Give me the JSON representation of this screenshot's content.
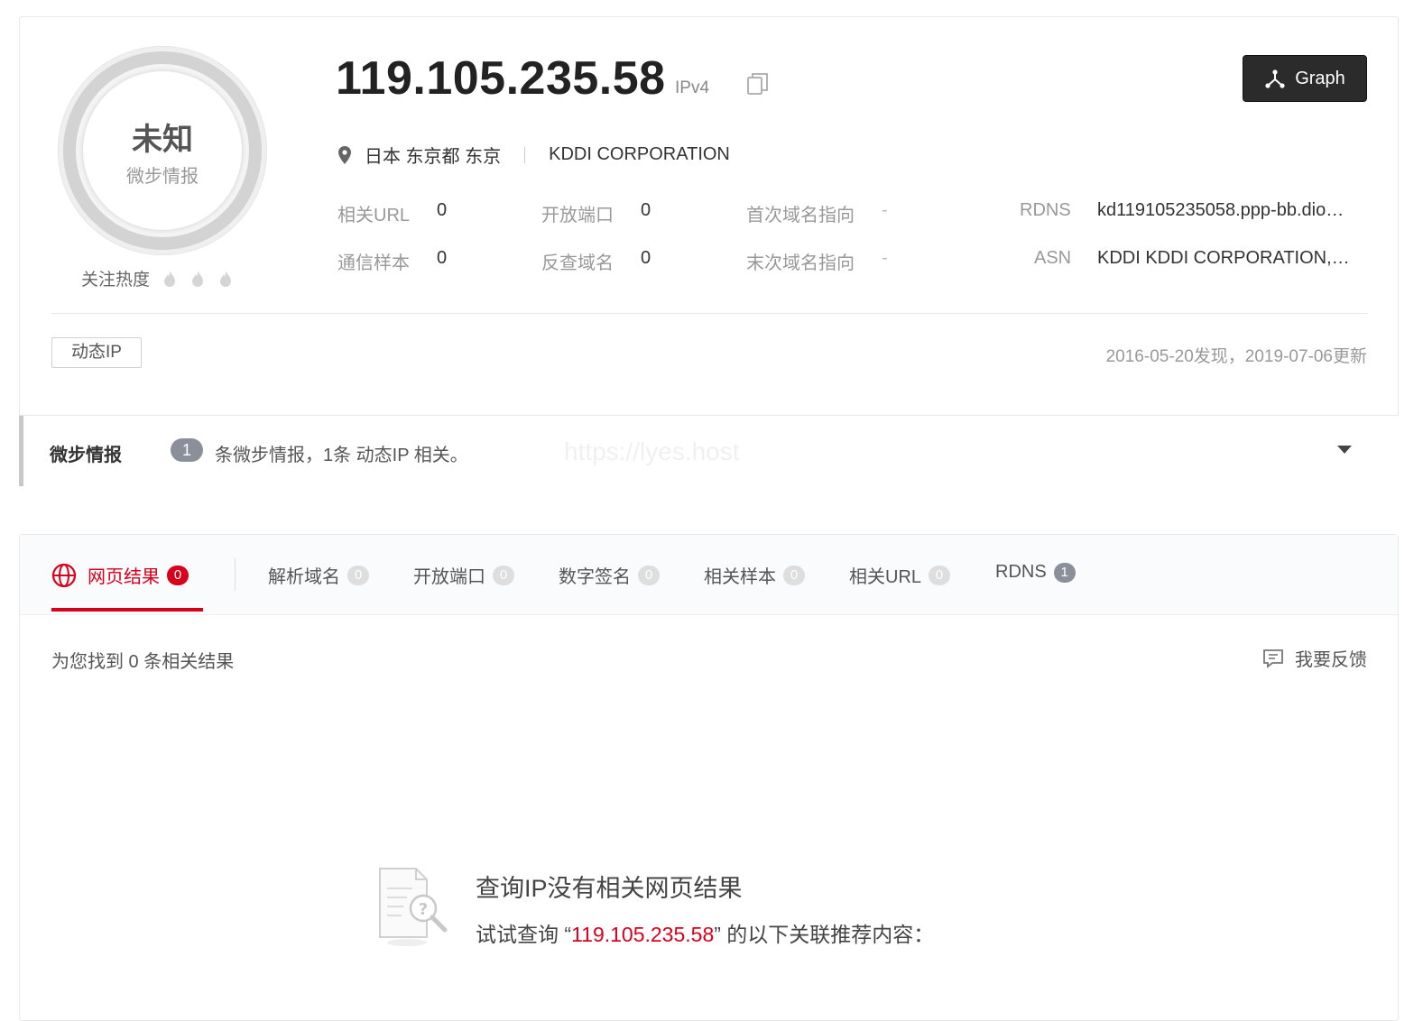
{
  "verdict": {
    "label": "未知",
    "source": "微步情报"
  },
  "heat": {
    "label": "关注热度",
    "level": 0,
    "max": 3
  },
  "ip": {
    "address": "119.105.235.58",
    "type": "IPv4"
  },
  "graph_button": {
    "label": "Graph"
  },
  "location": {
    "place": "日本 东京都 东京",
    "org": "KDDI CORPORATION"
  },
  "stats": {
    "related_url": {
      "label": "相关URL",
      "value": "0"
    },
    "open_ports": {
      "label": "开放端口",
      "value": "0"
    },
    "first_domain": {
      "label": "首次域名指向",
      "value": "-"
    },
    "rdns": {
      "label": "RDNS",
      "value": "kd119105235058.ppp-bb.dio…"
    },
    "samples": {
      "label": "通信样本",
      "value": "0"
    },
    "reverse_domain": {
      "label": "反查域名",
      "value": "0"
    },
    "last_domain": {
      "label": "末次域名指向",
      "value": "-"
    },
    "asn": {
      "label": "ASN",
      "value": "KDDI KDDI CORPORATION,…"
    }
  },
  "tag": "动态IP",
  "dates": "2016-05-20发现，2019-07-06更新",
  "intel": {
    "title": "微步情报",
    "count": "1",
    "text": "条微步情报，1条 动态IP 相关。",
    "watermark": "https://lyes.host"
  },
  "tabs": [
    {
      "label": "网页结果",
      "count": "0"
    },
    {
      "label": "解析域名",
      "count": "0"
    },
    {
      "label": "开放端口",
      "count": "0"
    },
    {
      "label": "数字签名",
      "count": "0"
    },
    {
      "label": "相关样本",
      "count": "0"
    },
    {
      "label": "相关URL",
      "count": "0"
    },
    {
      "label": "RDNS",
      "count": "1"
    }
  ],
  "results": {
    "count_text": "为您找到 0 条相关结果",
    "feedback": "我要反馈"
  },
  "empty": {
    "title": "查询IP没有相关网页结果",
    "sub_prefix": "试试查询 “",
    "sub_query": "119.105.235.58",
    "sub_suffix": "” 的以下关联推荐内容："
  },
  "colors": {
    "accent": "#d9001b",
    "dark_button": "#2b2b2b",
    "badge_gray": "#8a8f99"
  }
}
